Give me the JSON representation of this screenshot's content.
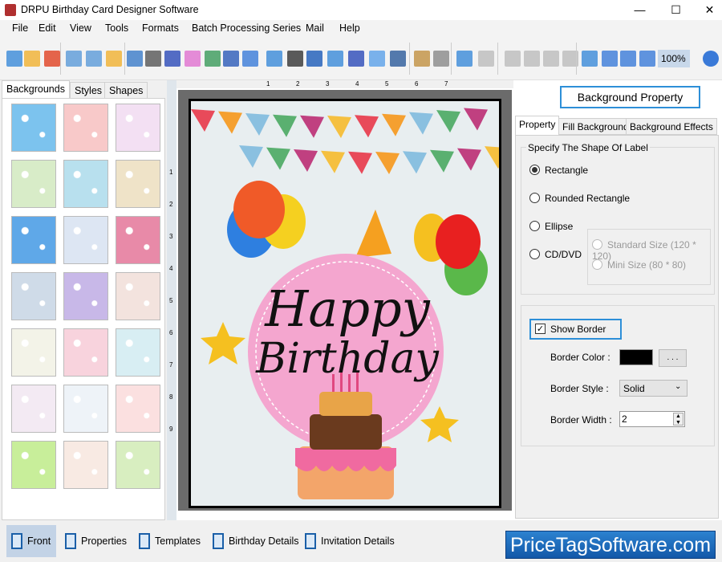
{
  "window": {
    "title": "DRPU Birthday Card Designer Software",
    "minimize": "—",
    "maximize": "☐",
    "close": "✕"
  },
  "menu": [
    "File",
    "Edit",
    "View",
    "Tools",
    "Formats",
    "Batch Processing Series",
    "Mail",
    "Help"
  ],
  "toolbar": {
    "icons": [
      "new-icon",
      "open-icon",
      "close-icon",
      "save-icon",
      "save-as-icon",
      "export-icon",
      "properties-icon",
      "print-icon",
      "layers-icon",
      "gift-icon",
      "image-icon",
      "pen-icon",
      "shapes-icon",
      "wordart-icon",
      "barcode-icon",
      "text-icon",
      "text-box-icon",
      "signature-icon",
      "mail-icon",
      "line-icon",
      "database-icon",
      "database2-icon",
      "undo-icon",
      "redo-icon",
      "cut-icon",
      "copy-icon",
      "paste-icon",
      "delete-icon",
      "grid-icon",
      "actual-size-icon",
      "fit-icon",
      "zoom-in-icon",
      "zoom-out-icon"
    ],
    "zoom": "100%"
  },
  "left_panel": {
    "tabs": [
      "Backgrounds",
      "Styles",
      "Shapes"
    ],
    "active_tab": "Backgrounds",
    "thumbnail_colors": [
      "#7cc3ee",
      "#f8c9c9",
      "#f3e0f3",
      "#d8ecc8",
      "#b8e0ee",
      "#efe3c8",
      "#5fa8e8",
      "#dde6f3",
      "#e88aa8",
      "#cfdbe8",
      "#c8b8e8",
      "#f3e3de",
      "#f3f3e8",
      "#f8d3dd",
      "#d8eef3",
      "#f3eaf3",
      "#eef3f8",
      "#fbe0e0",
      "#c8ee9a",
      "#f8eae3",
      "#d8eec0"
    ]
  },
  "ruler": {
    "labels": [
      "1",
      "2",
      "3",
      "4",
      "5",
      "6",
      "7"
    ],
    "vlabels": [
      "1",
      "2",
      "3",
      "4",
      "5",
      "6",
      "7",
      "8",
      "9"
    ]
  },
  "card": {
    "line1": "Happy",
    "line2": "Birthday",
    "border_color": "#000000",
    "circle_color": "#f4a6cf",
    "bg_color": "#e8eef0"
  },
  "right_panel": {
    "title_button": "Background Property",
    "tabs": [
      "Property",
      "Fill Background",
      "Background Effects"
    ],
    "active_tab": "Property",
    "shape_group": {
      "legend": "Specify The Shape Of Label",
      "options": [
        "Rectangle",
        "Rounded Rectangle",
        "Ellipse",
        "CD/DVD"
      ],
      "selected": "Rectangle",
      "cd_options": [
        "Standard Size (120 * 120)",
        "Mini Size (80 * 80)"
      ]
    },
    "border": {
      "show_border_label": "Show Border",
      "show_border": true,
      "color_label": "Border Color :",
      "color": "#000000",
      "browse": ". . .",
      "style_label": "Border Style :",
      "style": "Solid",
      "width_label": "Border Width :",
      "width": "2"
    }
  },
  "bottom_bar": {
    "tabs": [
      "Front",
      "Properties",
      "Templates",
      "Birthday Details",
      "Invitation Details"
    ],
    "active": "Front",
    "logo": "PriceTagSoftware.com"
  }
}
